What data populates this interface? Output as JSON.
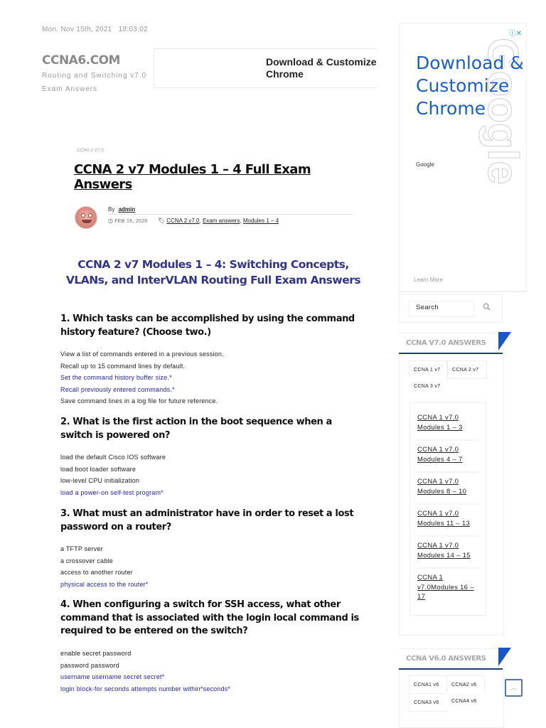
{
  "header": {
    "date": "Mon. Nov 15th, 2021",
    "time": "18:03:02",
    "site_name": "CCNA6.COM",
    "tagline_line1": "Routing and Switching v7.0",
    "tagline_line2": "Exam Answers"
  },
  "top_ad": {
    "text_line1": "Download & Customize",
    "text_line2": "Chrome"
  },
  "side_ad": {
    "headline": "Download & Customize Chrome",
    "brand": "Google",
    "watermark": "Google",
    "learn_more": "Learn More",
    "info_icon": "info-icon",
    "close_icon": "close-icon",
    "headline_color": "#1a5fc8"
  },
  "post": {
    "category": "CCNA 2 V7.0",
    "title": "CCNA 2 v7 Modules 1 – 4 Full Exam Answers",
    "by_label": "By",
    "author": "admin",
    "date": "FEB 16, 2020",
    "tags": [
      "CCNA 2 v7.0",
      "Exam answers",
      "Modules 1 – 4"
    ],
    "heading": "CCNA 2 v7 Modules 1 – 4: Switching Concepts, VLANs, and InterVLAN Routing Full Exam Answers",
    "heading_color": "#33338a",
    "correct_color": "#2222b8"
  },
  "questions": [
    {
      "text": "1. Which tasks can be accomplished by using the command history feature? (Choose two.)",
      "answers": [
        {
          "text": "View a list of commands entered in a previous session.",
          "correct": false
        },
        {
          "text": "Recall up to 15 command lines by default.",
          "correct": false
        },
        {
          "text": "Set the command history buffer size.*",
          "correct": true
        },
        {
          "text": "Recall previously entered commands.*",
          "correct": true
        },
        {
          "text": "Save command lines in a log file for future reference.",
          "correct": false
        }
      ]
    },
    {
      "text": "2. What is the first action in the boot sequence when a switch is powered on?",
      "answers": [
        {
          "text": "load the default Cisco IOS software",
          "correct": false
        },
        {
          "text": "load boot loader software",
          "correct": false
        },
        {
          "text": "low-level CPU initialization",
          "correct": false
        },
        {
          "text": "load a power-on self-test program*",
          "correct": true
        }
      ]
    },
    {
      "text": "3. What must an administrator have in order to reset a lost password on a router?",
      "answers": [
        {
          "text": "a TFTP server",
          "correct": false
        },
        {
          "text": "a crossover cable",
          "correct": false
        },
        {
          "text": "access to another router",
          "correct": false
        },
        {
          "text": "physical access to the router*",
          "correct": true
        }
      ]
    },
    {
      "text": "4. When configuring a switch for SSH access, what other command that is associated with the login local command is required to be entered on the switch?",
      "answers": [
        {
          "text": "enable secret password",
          "correct": false
        },
        {
          "text": "password password",
          "correct": false
        },
        {
          "text": "username username secret secret*",
          "correct": true
        },
        {
          "text": "login block-for seconds attempts number within*seconds*",
          "correct": true
        }
      ]
    }
  ],
  "sidebar": {
    "search_placeholder": "Search",
    "v7_widget": {
      "title": "CCNA V7.0 ANSWERS",
      "tabs": [
        "CCNA 1 v7",
        "CCNA 2 v7",
        "CCNA 3 v7"
      ],
      "links": [
        "CCNA 1 v7.0 Modules 1 – 3",
        "CCNA 1 v7.0 Modules 4 – 7",
        "CCNA 1 v7.0 Modules 8 – 10",
        "CCNA 1 v7.0 Modules 11 – 13",
        "CCNA 1 v7.0 Modules 14 – 15",
        "CCNA 1 v7.0Modules 16 – 17"
      ]
    },
    "v6_widget": {
      "title": "CCNA V6.0 ANSWERS",
      "tabs": [
        "CCNA1 v6",
        "CCNA2 v6",
        "CCNA3 v6",
        "CCNA4 v6"
      ]
    },
    "accent_color": "#1a56c8"
  },
  "scroll_top_icon": "chevron-up-icon"
}
